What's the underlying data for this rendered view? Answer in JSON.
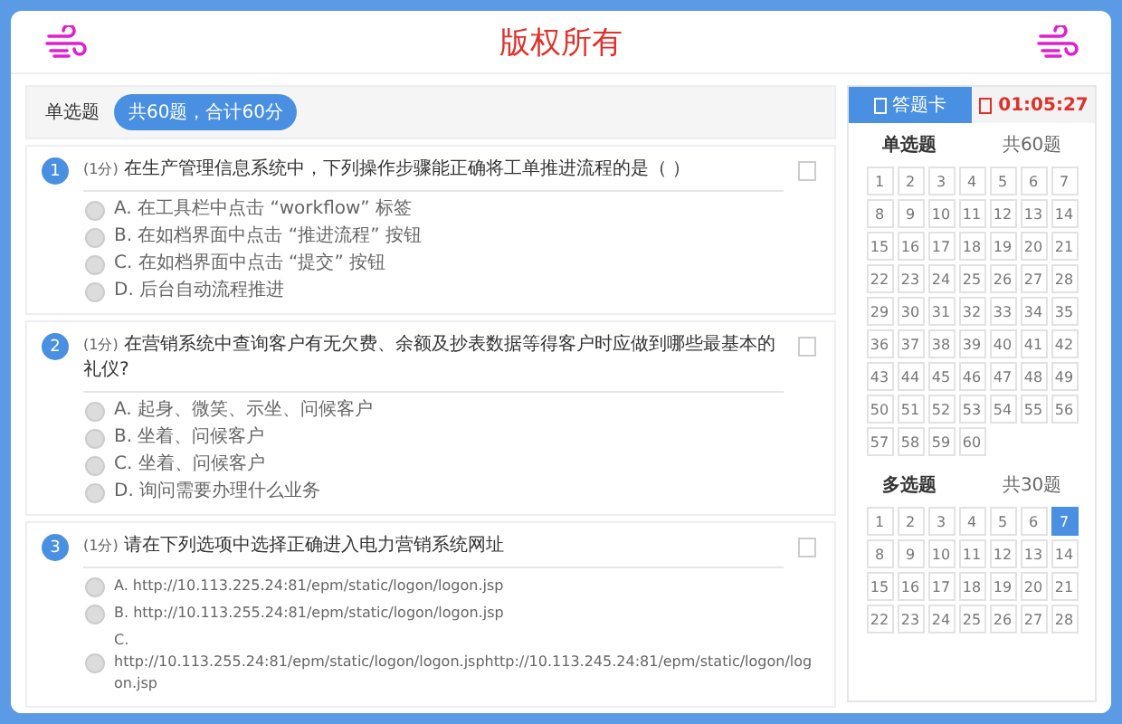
{
  "header": {
    "title": "版权所有"
  },
  "section": {
    "label": "单选题",
    "badge": "共60题，合计60分"
  },
  "questions": [
    {
      "number": "1",
      "flagged": false,
      "score": "(1分)",
      "text": "在生产管理信息系统中，下列操作步骤能正确将工单推进流程的是（ ）",
      "options": [
        {
          "label": "A. 在工具栏中点击 “workflow” 标签",
          "selected": false
        },
        {
          "label": "B. 在如档界面中点击 “推进流程” 按钮",
          "selected": false
        },
        {
          "label": "C. 在如档界面中点击 “提交” 按钮",
          "selected": false
        },
        {
          "label": "D. 后台自动流程推进",
          "selected": false
        }
      ]
    },
    {
      "number": "2",
      "flagged": false,
      "score": "(1分)",
      "text": "在营销系统中查询客户有无欠费、余额及抄表数据等得客户时应做到哪些最基本的礼仪?",
      "options": [
        {
          "label": "A. 起身、微笑、示坐、问候客户",
          "selected": false
        },
        {
          "label": "B. 坐着、问候客户",
          "selected": false
        },
        {
          "label": "C. 坐着、问候客户",
          "selected": false
        },
        {
          "label": "D. 询问需要办理什么业务",
          "selected": false
        }
      ]
    },
    {
      "number": "3",
      "flagged": false,
      "score": "(1分)",
      "text": "请在下列选项中选择正确进入电力营销系统网址",
      "options": [
        {
          "label": "A. http://10.113.225.24:81/epm/static/logon/logon.jsp",
          "selected": false
        },
        {
          "label": "B. http://10.113.255.24:81/epm/static/logon/logon.jsp",
          "selected": false
        },
        {
          "label": "C. http://10.113.255.24:81/epm/static/logon/logon.jsphttp://10.113.245.24:81/epm/static/logon/logon.jsp",
          "selected": false
        }
      ]
    }
  ],
  "answer_card": {
    "tab": "答题卡",
    "timer": "01:05:27",
    "groups": [
      {
        "title": "单选题",
        "count": "共60题",
        "items": [
          {
            "label": "1",
            "current": false
          },
          {
            "label": "2",
            "current": false
          },
          {
            "label": "3",
            "current": false
          },
          {
            "label": "4",
            "current": false
          },
          {
            "label": "5",
            "current": false
          },
          {
            "label": "6",
            "current": false
          },
          {
            "label": "7",
            "current": false
          },
          {
            "label": "8",
            "current": false
          },
          {
            "label": "9",
            "current": false
          },
          {
            "label": "10",
            "current": false
          },
          {
            "label": "11",
            "current": false
          },
          {
            "label": "12",
            "current": false
          },
          {
            "label": "13",
            "current": false
          },
          {
            "label": "14",
            "current": false
          },
          {
            "label": "15",
            "current": false
          },
          {
            "label": "16",
            "current": false
          },
          {
            "label": "17",
            "current": false
          },
          {
            "label": "18",
            "current": false
          },
          {
            "label": "19",
            "current": false
          },
          {
            "label": "20",
            "current": false
          },
          {
            "label": "21",
            "current": false
          },
          {
            "label": "22",
            "current": false
          },
          {
            "label": "23",
            "current": false
          },
          {
            "label": "24",
            "current": false
          },
          {
            "label": "25",
            "current": false
          },
          {
            "label": "26",
            "current": false
          },
          {
            "label": "27",
            "current": false
          },
          {
            "label": "28",
            "current": false
          },
          {
            "label": "29",
            "current": false
          },
          {
            "label": "30",
            "current": false
          },
          {
            "label": "31",
            "current": false
          },
          {
            "label": "32",
            "current": false
          },
          {
            "label": "33",
            "current": false
          },
          {
            "label": "34",
            "current": false
          },
          {
            "label": "35",
            "current": false
          },
          {
            "label": "36",
            "current": false
          },
          {
            "label": "37",
            "current": false
          },
          {
            "label": "38",
            "current": false
          },
          {
            "label": "39",
            "current": false
          },
          {
            "label": "40",
            "current": false
          },
          {
            "label": "41",
            "current": false
          },
          {
            "label": "42",
            "current": false
          },
          {
            "label": "43",
            "current": false
          },
          {
            "label": "44",
            "current": false
          },
          {
            "label": "45",
            "current": false
          },
          {
            "label": "46",
            "current": false
          },
          {
            "label": "47",
            "current": false
          },
          {
            "label": "48",
            "current": false
          },
          {
            "label": "49",
            "current": false
          },
          {
            "label": "50",
            "current": false
          },
          {
            "label": "51",
            "current": false
          },
          {
            "label": "52",
            "current": false
          },
          {
            "label": "53",
            "current": false
          },
          {
            "label": "54",
            "current": false
          },
          {
            "label": "55",
            "current": false
          },
          {
            "label": "56",
            "current": false
          },
          {
            "label": "57",
            "current": false
          },
          {
            "label": "58",
            "current": false
          },
          {
            "label": "59",
            "current": false
          },
          {
            "label": "60",
            "current": false
          }
        ]
      },
      {
        "title": "多选题",
        "count": "共30题",
        "items": [
          {
            "label": "1",
            "current": false
          },
          {
            "label": "2",
            "current": false
          },
          {
            "label": "3",
            "current": false
          },
          {
            "label": "4",
            "current": false
          },
          {
            "label": "5",
            "current": false
          },
          {
            "label": "6",
            "current": false
          },
          {
            "label": "7",
            "current": true
          },
          {
            "label": "8",
            "current": false
          },
          {
            "label": "9",
            "current": false
          },
          {
            "label": "10",
            "current": false
          },
          {
            "label": "11",
            "current": false
          },
          {
            "label": "12",
            "current": false
          },
          {
            "label": "13",
            "current": false
          },
          {
            "label": "14",
            "current": false
          },
          {
            "label": "15",
            "current": false
          },
          {
            "label": "16",
            "current": false
          },
          {
            "label": "17",
            "current": false
          },
          {
            "label": "18",
            "current": false
          },
          {
            "label": "19",
            "current": false
          },
          {
            "label": "20",
            "current": false
          },
          {
            "label": "21",
            "current": false
          },
          {
            "label": "22",
            "current": false
          },
          {
            "label": "23",
            "current": false
          },
          {
            "label": "24",
            "current": false
          },
          {
            "label": "25",
            "current": false
          },
          {
            "label": "26",
            "current": false
          },
          {
            "label": "27",
            "current": false
          },
          {
            "label": "28",
            "current": false
          }
        ]
      }
    ]
  }
}
